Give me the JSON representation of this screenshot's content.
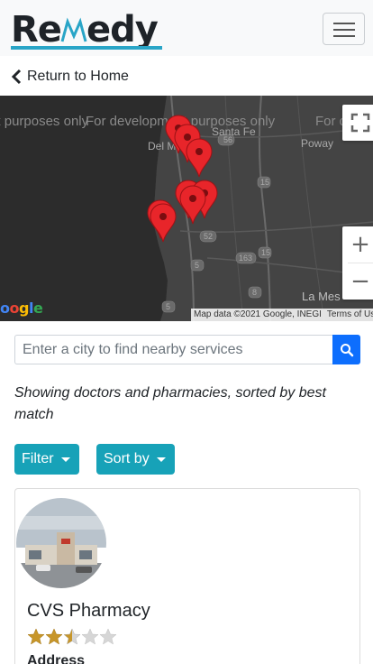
{
  "brand": {
    "logo_text": "ReMedy",
    "accent_color": "#29a5c7"
  },
  "nav": {
    "menu_toggle_icon": "hamburger-icon"
  },
  "return_link": {
    "label": "Return to Home",
    "icon": "chevron-left-icon"
  },
  "map": {
    "watermark_text": "For development purposes only",
    "places": [
      "Santa Fe",
      "Del M",
      "Poway",
      "La Mes"
    ],
    "road_shields": [
      "56",
      "15",
      "52",
      "5",
      "163",
      "15",
      "8",
      "5"
    ],
    "attribution": "Map data ©2021 Google, INEGI",
    "terms": "Terms of Use",
    "google_logo": "Google",
    "marker_color": "#e8252a",
    "controls": {
      "fullscreen_icon": "fullscreen-icon",
      "zoom_in": "+",
      "zoom_out": "−"
    }
  },
  "search": {
    "placeholder": "Enter a city to find nearby services",
    "button_icon": "search-icon",
    "button_color": "#0d6efd"
  },
  "results_info": "Showing doctors and pharmacies, sorted by best match",
  "filter_button": {
    "label": "Filter"
  },
  "sort_button": {
    "label": "Sort by"
  },
  "button_color": "#17a2b8",
  "result_card": {
    "title": "CVS Pharmacy",
    "rating": 2.5,
    "max_rating": 5,
    "address_label": "Address"
  }
}
